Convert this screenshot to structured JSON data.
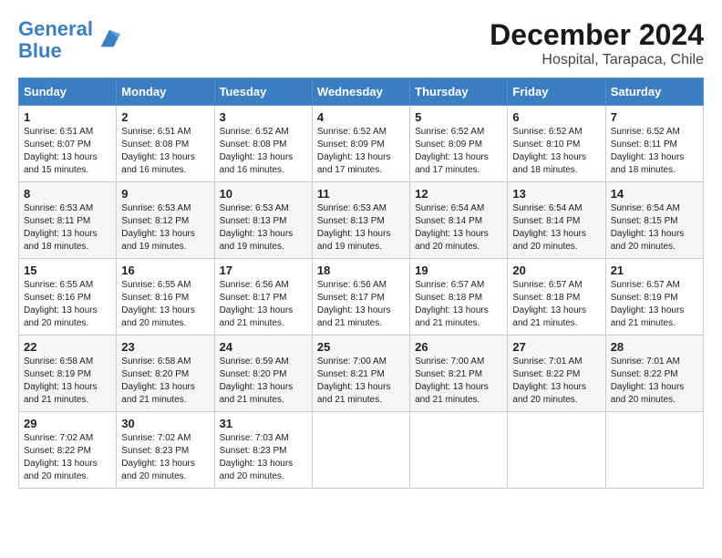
{
  "header": {
    "logo_line1": "General",
    "logo_line2": "Blue",
    "title": "December 2024",
    "subtitle": "Hospital, Tarapaca, Chile"
  },
  "calendar": {
    "days_of_week": [
      "Sunday",
      "Monday",
      "Tuesday",
      "Wednesday",
      "Thursday",
      "Friday",
      "Saturday"
    ],
    "weeks": [
      [
        {
          "day": "1",
          "info": "Sunrise: 6:51 AM\nSunset: 8:07 PM\nDaylight: 13 hours\nand 15 minutes."
        },
        {
          "day": "2",
          "info": "Sunrise: 6:51 AM\nSunset: 8:08 PM\nDaylight: 13 hours\nand 16 minutes."
        },
        {
          "day": "3",
          "info": "Sunrise: 6:52 AM\nSunset: 8:08 PM\nDaylight: 13 hours\nand 16 minutes."
        },
        {
          "day": "4",
          "info": "Sunrise: 6:52 AM\nSunset: 8:09 PM\nDaylight: 13 hours\nand 17 minutes."
        },
        {
          "day": "5",
          "info": "Sunrise: 6:52 AM\nSunset: 8:09 PM\nDaylight: 13 hours\nand 17 minutes."
        },
        {
          "day": "6",
          "info": "Sunrise: 6:52 AM\nSunset: 8:10 PM\nDaylight: 13 hours\nand 18 minutes."
        },
        {
          "day": "7",
          "info": "Sunrise: 6:52 AM\nSunset: 8:11 PM\nDaylight: 13 hours\nand 18 minutes."
        }
      ],
      [
        {
          "day": "8",
          "info": "Sunrise: 6:53 AM\nSunset: 8:11 PM\nDaylight: 13 hours\nand 18 minutes."
        },
        {
          "day": "9",
          "info": "Sunrise: 6:53 AM\nSunset: 8:12 PM\nDaylight: 13 hours\nand 19 minutes."
        },
        {
          "day": "10",
          "info": "Sunrise: 6:53 AM\nSunset: 8:13 PM\nDaylight: 13 hours\nand 19 minutes."
        },
        {
          "day": "11",
          "info": "Sunrise: 6:53 AM\nSunset: 8:13 PM\nDaylight: 13 hours\nand 19 minutes."
        },
        {
          "day": "12",
          "info": "Sunrise: 6:54 AM\nSunset: 8:14 PM\nDaylight: 13 hours\nand 20 minutes."
        },
        {
          "day": "13",
          "info": "Sunrise: 6:54 AM\nSunset: 8:14 PM\nDaylight: 13 hours\nand 20 minutes."
        },
        {
          "day": "14",
          "info": "Sunrise: 6:54 AM\nSunset: 8:15 PM\nDaylight: 13 hours\nand 20 minutes."
        }
      ],
      [
        {
          "day": "15",
          "info": "Sunrise: 6:55 AM\nSunset: 8:16 PM\nDaylight: 13 hours\nand 20 minutes."
        },
        {
          "day": "16",
          "info": "Sunrise: 6:55 AM\nSunset: 8:16 PM\nDaylight: 13 hours\nand 20 minutes."
        },
        {
          "day": "17",
          "info": "Sunrise: 6:56 AM\nSunset: 8:17 PM\nDaylight: 13 hours\nand 21 minutes."
        },
        {
          "day": "18",
          "info": "Sunrise: 6:56 AM\nSunset: 8:17 PM\nDaylight: 13 hours\nand 21 minutes."
        },
        {
          "day": "19",
          "info": "Sunrise: 6:57 AM\nSunset: 8:18 PM\nDaylight: 13 hours\nand 21 minutes."
        },
        {
          "day": "20",
          "info": "Sunrise: 6:57 AM\nSunset: 8:18 PM\nDaylight: 13 hours\nand 21 minutes."
        },
        {
          "day": "21",
          "info": "Sunrise: 6:57 AM\nSunset: 8:19 PM\nDaylight: 13 hours\nand 21 minutes."
        }
      ],
      [
        {
          "day": "22",
          "info": "Sunrise: 6:58 AM\nSunset: 8:19 PM\nDaylight: 13 hours\nand 21 minutes."
        },
        {
          "day": "23",
          "info": "Sunrise: 6:58 AM\nSunset: 8:20 PM\nDaylight: 13 hours\nand 21 minutes."
        },
        {
          "day": "24",
          "info": "Sunrise: 6:59 AM\nSunset: 8:20 PM\nDaylight: 13 hours\nand 21 minutes."
        },
        {
          "day": "25",
          "info": "Sunrise: 7:00 AM\nSunset: 8:21 PM\nDaylight: 13 hours\nand 21 minutes."
        },
        {
          "day": "26",
          "info": "Sunrise: 7:00 AM\nSunset: 8:21 PM\nDaylight: 13 hours\nand 21 minutes."
        },
        {
          "day": "27",
          "info": "Sunrise: 7:01 AM\nSunset: 8:22 PM\nDaylight: 13 hours\nand 20 minutes."
        },
        {
          "day": "28",
          "info": "Sunrise: 7:01 AM\nSunset: 8:22 PM\nDaylight: 13 hours\nand 20 minutes."
        }
      ],
      [
        {
          "day": "29",
          "info": "Sunrise: 7:02 AM\nSunset: 8:22 PM\nDaylight: 13 hours\nand 20 minutes."
        },
        {
          "day": "30",
          "info": "Sunrise: 7:02 AM\nSunset: 8:23 PM\nDaylight: 13 hours\nand 20 minutes."
        },
        {
          "day": "31",
          "info": "Sunrise: 7:03 AM\nSunset: 8:23 PM\nDaylight: 13 hours\nand 20 minutes."
        },
        {
          "day": "",
          "info": ""
        },
        {
          "day": "",
          "info": ""
        },
        {
          "day": "",
          "info": ""
        },
        {
          "day": "",
          "info": ""
        }
      ]
    ]
  }
}
